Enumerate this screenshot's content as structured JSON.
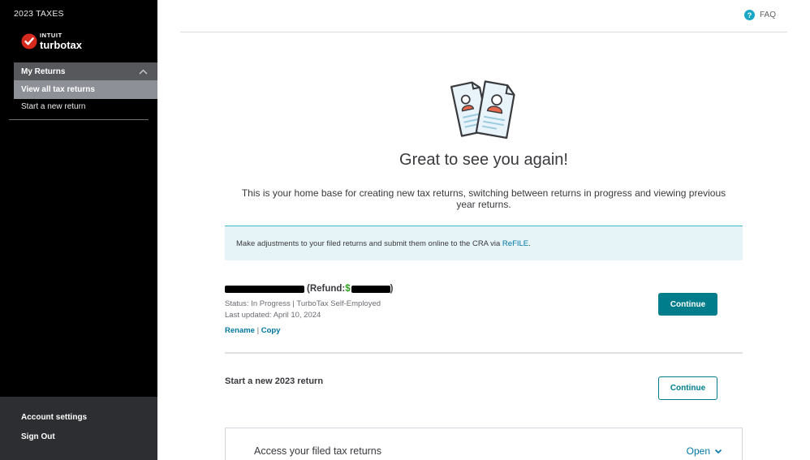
{
  "sidebar": {
    "year_label": "2023 TAXES",
    "logo": {
      "brand_top": "INTUIT",
      "brand_main": "turbotax",
      "accent_color": "#d52b1e"
    },
    "nav": {
      "group_label": "My Returns",
      "active_item": "View all tax returns",
      "item": "Start a new return"
    },
    "bottom": {
      "account_settings": "Account settings",
      "sign_out": "Sign Out"
    }
  },
  "header": {
    "faq_icon": "?",
    "faq_label": "FAQ"
  },
  "main": {
    "title": "Great to see you again!",
    "intro": "This is your home base for creating new tax returns, switching between returns in progress and viewing previous year returns.",
    "banner": {
      "text": "Make adjustments to your filed returns and submit them online to the CRA via ",
      "link": "ReFILE",
      "suffix": "."
    },
    "return_item": {
      "refund_label": "(Refund: ",
      "refund_currency": "$",
      "refund_close": ")",
      "status": "Status: In Progress | TurboTax Self-Employed",
      "updated": "Last updated: April 10, 2024",
      "rename": "Rename",
      "separator": "|",
      "copy": "Copy",
      "continue": "Continue"
    },
    "new_return": {
      "label": "Start a new 2023 return",
      "continue": "Continue"
    },
    "accordion": {
      "title": "Access your filed tax returns",
      "toggle": "Open"
    }
  },
  "colors": {
    "sidebar_bg": "#000000",
    "nav_group_bg": "#57585b",
    "nav_active_bg": "#8d9096",
    "primary": "#007d8a",
    "link": "#0077a3",
    "refund_green": "#2ca01c",
    "banner_bg": "#e6f4f8"
  }
}
